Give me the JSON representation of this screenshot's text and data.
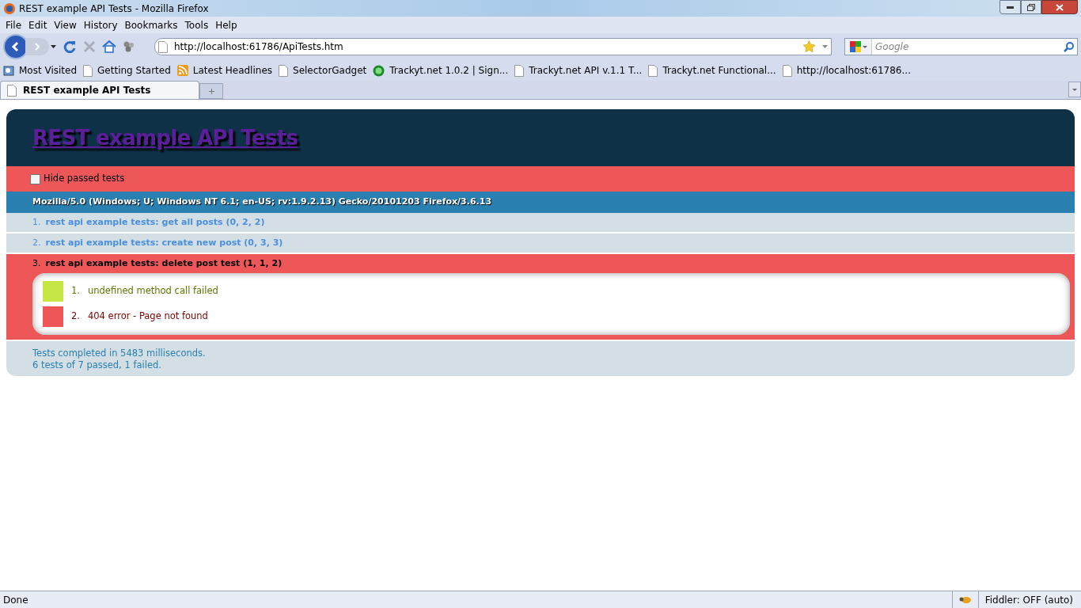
{
  "window": {
    "title": "REST example API Tests - Mozilla Firefox"
  },
  "menu": [
    "File",
    "Edit",
    "View",
    "History",
    "Bookmarks",
    "Tools",
    "Help"
  ],
  "address": {
    "value": "http://localhost:61786/ApiTests.htm"
  },
  "search": {
    "placeholder": "Google"
  },
  "bookmarks": [
    {
      "label": "Most Visited",
      "kind": "folder"
    },
    {
      "label": "Getting Started",
      "kind": "page"
    },
    {
      "label": "Latest Headlines",
      "kind": "feed"
    },
    {
      "label": "SelectorGadget",
      "kind": "page"
    },
    {
      "label": "Trackyt.net 1.0.2 | Sign...",
      "kind": "site"
    },
    {
      "label": "Trackyt.net API v.1.1 T...",
      "kind": "page"
    },
    {
      "label": "Trackyt.net Functional...",
      "kind": "page"
    },
    {
      "label": "http://localhost:61786...",
      "kind": "page"
    }
  ],
  "tabs": [
    {
      "label": "REST example API Tests",
      "selected": true
    }
  ],
  "page": {
    "title": "REST example API Tests",
    "hide_passed": {
      "label": "Hide passed tests",
      "checked": false
    },
    "user_agent": "Mozilla/5.0 (Windows; U; Windows NT 6.1; en-US; rv:1.9.2.13) Gecko/20101203 Firefox/3.6.13",
    "tests": [
      {
        "number": "1.",
        "name": "rest api example tests: get all posts (0, 2, 2)",
        "kind": "pass"
      },
      {
        "number": "2.",
        "name": "rest api example tests: create new post (0, 3, 3)",
        "kind": "pass"
      },
      {
        "number": "3.",
        "name": "rest api example tests: delete post test (1, 1, 2)",
        "kind": "fail",
        "assertions": [
          {
            "number": "1.",
            "message": "undefined method call failed",
            "kind": "pass"
          },
          {
            "number": "2.",
            "message": "404 error - Page not found",
            "kind": "fail"
          }
        ]
      }
    ],
    "summary": [
      "Tests completed in 5483 milliseconds.",
      "6 tests of 7 passed, 1 failed."
    ]
  },
  "status_bar": {
    "text": "Done",
    "fiddler": "Fiddler: OFF (auto)"
  }
}
